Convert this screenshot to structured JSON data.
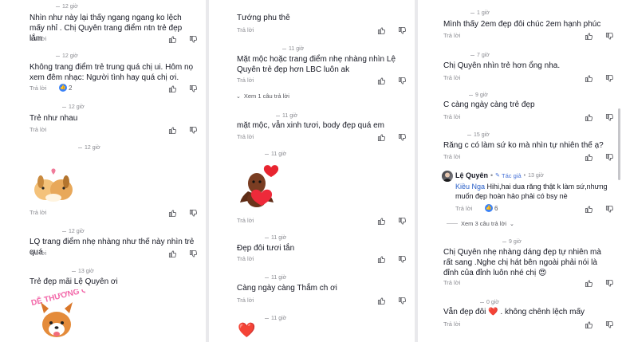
{
  "reply_label": "Trả lời",
  "column1": [
    {
      "time": "12 giờ",
      "text": "Nhìn như này lại thấy ngang ngang ko lệch mấy nhỉ . Chị Quyên trang điểm ntn trẻ đẹp lắm"
    },
    {
      "time": "12 giờ",
      "text": "Không trang điểm trẻ trung quá chị ui. Hôm nọ xem đêm nhạc: Người tình hay quá chị ơi.",
      "likes": "2"
    },
    {
      "time": "12 giờ",
      "text": "Trẻ như nhau"
    },
    {
      "time": "12 giờ",
      "sticker": "dogs-hug-sticker"
    },
    {
      "time": "12 giờ",
      "text": "LQ trang điểm nhẹ nhàng như thế này nhìn trẻ quá"
    },
    {
      "time": "13 giờ",
      "text": "Trẻ đẹp mãi Lệ Quyên ơi",
      "sticker_text": "DỄ THƯƠNG QUÁ"
    }
  ],
  "column2": [
    {
      "text": "Tướng phu thê"
    },
    {
      "time": "11 giờ",
      "text": "Mặt mộc hoặc trang điểm nhẹ nhàng nhìn Lệ Quyên trẻ đẹp hơn LBC luôn ak",
      "more": "Xem 1 câu trả lời"
    },
    {
      "time": "11 giờ",
      "text": "mặt mộc, vẫn xinh tươi, body đẹp quá em"
    },
    {
      "time": "11 giờ",
      "sticker": "character-hearts-sticker"
    },
    {
      "time": "11 giờ",
      "text": "Đẹp đôi tươi tắn"
    },
    {
      "time": "11 giờ",
      "text": "Càng ngày càng Thắm ch ơi"
    },
    {
      "time": "11 giờ",
      "emoji": "❤️"
    }
  ],
  "column3": [
    {
      "time": "1 giờ",
      "text": "Mình thấy 2em đẹp đôi chúc 2em hạnh phúc"
    },
    {
      "time": "7 giờ",
      "text": "Chị Quyên nhìn trẻ hơn ổng nha."
    },
    {
      "time": "9 giờ",
      "text": "C càng ngày càng trẻ đẹp"
    },
    {
      "time": "15 giờ",
      "text": "Răng c có làm sứ ko mà nhìn tự nhiên thế ạ?"
    },
    {
      "author": "Lệ Quyên",
      "author_tag": "Tác giả",
      "time": "13 giờ",
      "mention": "Kiều Nga",
      "text": " Hihi,hai dua răng thật k làm sứ,nhưng muốn đẹp hoàn hảo phải có bsy nè",
      "likes": "6",
      "more": "Xem 3 câu trả lời"
    },
    {
      "time": "9 giờ",
      "text": "Chị Quyên nhẹ nhàng dáng đẹp tự nhiên mà rất sang .Nghe chị hát bên ngoài phải nói là đỉnh của đỉnh luôn nhé chị 😍"
    },
    {
      "time": "0 giờ",
      "text_a": "Vẫn đẹp đôi ",
      "emoji": "❤️",
      "text_b": " . không chênh lệch mấy"
    }
  ]
}
